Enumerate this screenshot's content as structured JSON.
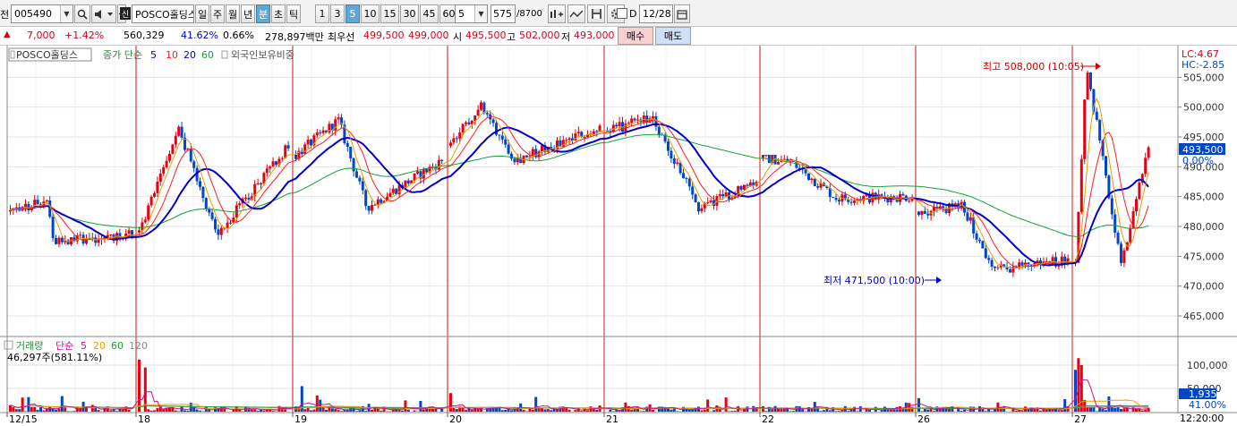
{
  "toolbar": {
    "left_clip": "전",
    "code": "005490",
    "stock_name": "POSCO홀딩스",
    "period_tabs": [
      {
        "label": "일",
        "active": false
      },
      {
        "label": "주",
        "active": false
      },
      {
        "label": "월",
        "active": false
      },
      {
        "label": "년",
        "active": false
      },
      {
        "label": "분",
        "active": true
      },
      {
        "label": "초",
        "active": false
      },
      {
        "label": "틱",
        "active": false
      }
    ],
    "interval_buttons": [
      {
        "label": "1",
        "active": false
      },
      {
        "label": "3",
        "active": false
      },
      {
        "label": "5",
        "active": true
      },
      {
        "label": "10",
        "active": false
      },
      {
        "label": "15",
        "active": false
      },
      {
        "label": "30",
        "active": false
      },
      {
        "label": "45",
        "active": false
      },
      {
        "label": "60",
        "active": false
      }
    ],
    "interval_select": "5",
    "count_value": "575",
    "count_total": "/8700",
    "date_checkbox_label": "D",
    "date_value": "12/28"
  },
  "quote": {
    "arrow": "▲",
    "change": "7,000",
    "change_pct": "+1.42%",
    "volume": "560,329",
    "volume_ratio": "41.62%",
    "turnover_pct": "0.66%",
    "amount": "278,897백만",
    "best_label": "최우선",
    "best_ask": "499,500",
    "best_bid": "499,000",
    "open_label": "시",
    "open": "495,500",
    "high_label": "고",
    "high": "502,000",
    "low_label": "저",
    "low": "493,000",
    "buy_label": "매수",
    "sell_label": "매도"
  },
  "chart_data": {
    "type": "candlestick",
    "price_panel": {
      "legend": {
        "name": "POSCO홀딩스",
        "ma_label": "종가 단순",
        "ma_periods": [
          "5",
          "10",
          "20",
          "60"
        ],
        "extra": "외국인보유비중"
      },
      "y_ticks": [
        "505,000",
        "500,000",
        "495,000",
        "490,000",
        "485,000",
        "480,000",
        "475,000",
        "470,000",
        "465,000"
      ],
      "ylim": [
        462000,
        508500
      ],
      "current_price": "493,500",
      "current_pct": "0.00%",
      "lc": "LC:4.67",
      "hc": "HC:-2.85",
      "high_annotation": "최고 508,000 (10:05)",
      "low_annotation": "최저 471,500 (10:00)",
      "session_ranges": [
        {
          "date": "12/15",
          "o": 482500,
          "c": 478500,
          "hi": 485500,
          "lo": 476500
        },
        {
          "date": "18",
          "o": 479000,
          "c": 493500,
          "hi": 498000,
          "lo": 477500
        },
        {
          "date": "19",
          "o": 492000,
          "c": 491000,
          "hi": 499000,
          "lo": 482000
        },
        {
          "date": "20",
          "o": 493500,
          "c": 496500,
          "hi": 501500,
          "lo": 490000
        },
        {
          "date": "21",
          "o": 496000,
          "c": 487500,
          "hi": 499500,
          "lo": 482000
        },
        {
          "date": "22",
          "o": 491500,
          "c": 485000,
          "hi": 492000,
          "lo": 483500
        },
        {
          "date": "26",
          "o": 482500,
          "c": 474500,
          "hi": 484500,
          "lo": 471500
        },
        {
          "date": "27",
          "o": 474000,
          "c": 493500,
          "hi": 508000,
          "lo": 472000
        }
      ]
    },
    "volume_panel": {
      "legend": {
        "name": "거래량",
        "ma_label": "단순",
        "ma_periods": [
          "5",
          "20",
          "60",
          "120"
        ]
      },
      "value_label": "46,297주(581.11%)",
      "y_ticks": [
        "100,000",
        "50,000"
      ],
      "ylim": [
        0,
        125000
      ],
      "current_value": "1,935",
      "current_pct": "41.00%",
      "typical_max": 35000,
      "spikes": [
        {
          "session": 1,
          "pos": 0.0,
          "value": 112000
        },
        {
          "session": 1,
          "pos": 0.05,
          "value": 95000
        },
        {
          "session": 2,
          "pos": 0.05,
          "value": 55000
        },
        {
          "session": 3,
          "pos": 0.0,
          "value": 40000
        },
        {
          "session": 7,
          "pos": 0.02,
          "value": 90000
        },
        {
          "session": 7,
          "pos": 0.06,
          "value": 115000
        },
        {
          "session": 7,
          "pos": 0.09,
          "value": 100000
        }
      ]
    },
    "x_labels": [
      "12/15",
      "18",
      "19",
      "20",
      "21",
      "22",
      "26",
      "27"
    ],
    "x_end_label": "12:20:00",
    "colors": {
      "up": "#e60012",
      "down": "#0046c8",
      "ma5": "#0000c8",
      "ma10": "#ff1e1e",
      "ma20": "#e6a000",
      "ma60": "#14a03c",
      "session_line": "#d21414"
    }
  }
}
